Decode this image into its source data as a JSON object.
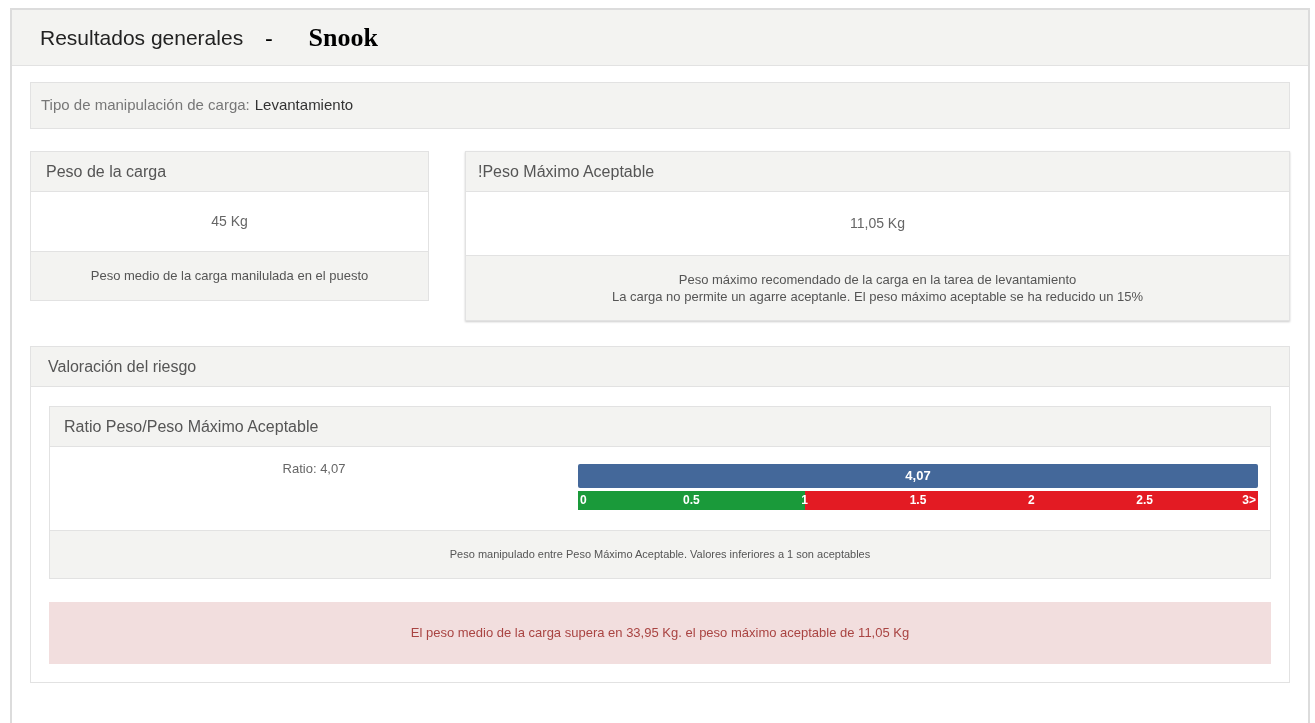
{
  "header": {
    "title": "Resultados generales",
    "separator": "-",
    "subject": "Snook"
  },
  "manipulation": {
    "label": "Tipo de manipulación de carga:",
    "value": "Levantamiento"
  },
  "load_card": {
    "title": "Peso de la carga",
    "value": "45 Kg",
    "note": "Peso medio de la carga manilulada en el puesto"
  },
  "max_card": {
    "title": "!Peso Máximo Aceptable",
    "value": "11,05 Kg",
    "notes": [
      "Peso máximo recomendado de la carga en la tarea de levantamiento",
      "La carga no permite un agarre aceptanle. El peso máximo aceptable se ha reducido un 15%"
    ]
  },
  "risk": {
    "title": "Valoración del riesgo",
    "ratio_card": {
      "title": "Ratio Peso/Peso Máximo Aceptable",
      "ratio_text": "Ratio: 4,07",
      "bar": {
        "level": 1,
        "label": "4,07"
      },
      "scale": [
        {
          "label": "0",
          "color": "#1a9a3a"
        },
        {
          "label": "0.5",
          "color": "#1a9a3a"
        },
        {
          "label": "1",
          "color": "#e31b23"
        },
        {
          "label": "1.5",
          "color": "#e31b23"
        },
        {
          "label": "2",
          "color": "#e31b23"
        },
        {
          "label": "2.5",
          "color": "#e31b23"
        }
      ],
      "scale_end": "3>",
      "note": "Peso manipulado entre Peso Máximo Aceptable. Valores inferiores a 1 son aceptables"
    },
    "alert": "El peso medio de la carga supera en 33,95 Kg. el peso máximo aceptable de 11,05 Kg"
  }
}
